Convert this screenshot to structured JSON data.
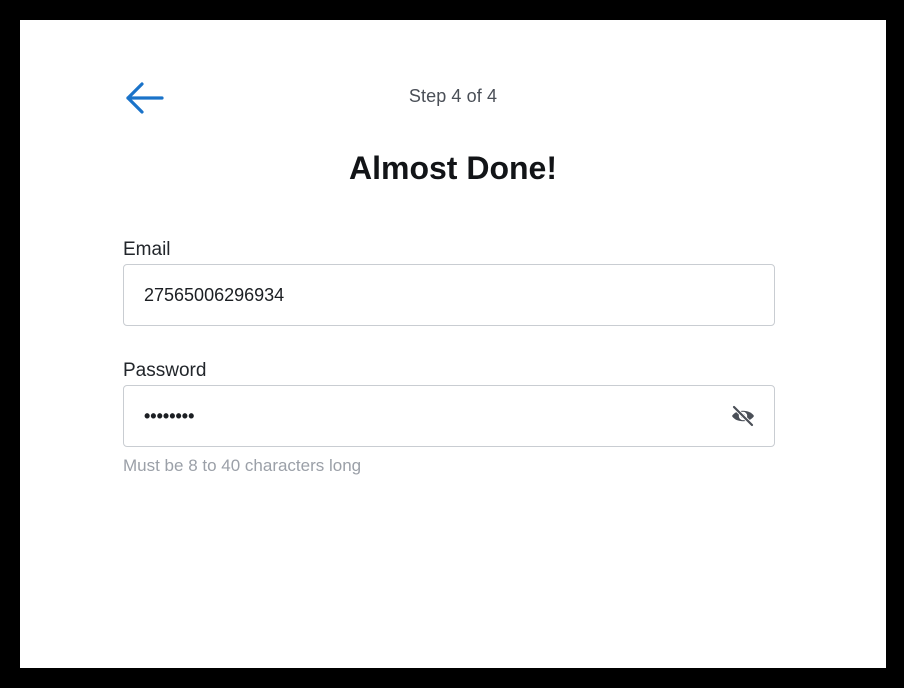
{
  "header": {
    "back_icon": "arrow-left-icon",
    "step_text": "Step 4 of 4",
    "title": "Almost Done!"
  },
  "form": {
    "email": {
      "label": "Email",
      "value": "27565006296934"
    },
    "password": {
      "label": "Password",
      "value": "••••••••",
      "toggle_icon": "eye-slash-icon",
      "helper": "Must be 8 to 40 characters long"
    }
  },
  "colors": {
    "accent": "#1a73c9",
    "border": "#c9cdd2",
    "helper": "#9ba0a8",
    "frame": "#000000"
  }
}
